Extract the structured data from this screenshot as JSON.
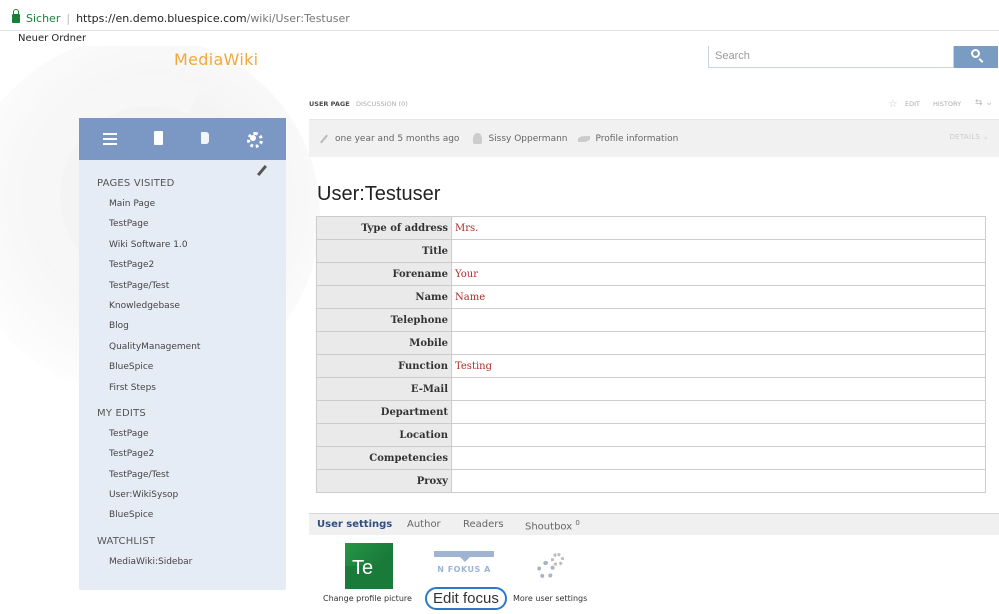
{
  "browser": {
    "secure_label": "Sicher",
    "url_host": "https://en.demo.bluespice.com",
    "url_path": "/wiki/User:Testuser",
    "bookmark": "Neuer Ordner"
  },
  "header": {
    "logo": "MediaWiki",
    "search_placeholder": "Search"
  },
  "topnav": {
    "user_page": "USER PAGE",
    "discussion": "DISCUSSION (0)",
    "edit": "EDIT",
    "history": "HISTORY"
  },
  "infobar": {
    "edited": "one year and 5 months ago",
    "author": "Sissy Oppermann",
    "profile": "Profile information",
    "details": "DETAILS"
  },
  "page_title": "User:Testuser",
  "profile": [
    {
      "label": "Type of address",
      "value": "Mrs."
    },
    {
      "label": "Title",
      "value": ""
    },
    {
      "label": "Forename",
      "value": "Your"
    },
    {
      "label": "Name",
      "value": "Name"
    },
    {
      "label": "Telephone",
      "value": ""
    },
    {
      "label": "Mobile",
      "value": ""
    },
    {
      "label": "Function",
      "value": "Testing"
    },
    {
      "label": "E-Mail",
      "value": ""
    },
    {
      "label": "Department",
      "value": ""
    },
    {
      "label": "Location",
      "value": ""
    },
    {
      "label": "Competencies",
      "value": ""
    },
    {
      "label": "Proxy",
      "value": ""
    }
  ],
  "sidebar": {
    "pages_visited_heading": "PAGES VISITED",
    "pages_visited": [
      "Main Page",
      "TestPage",
      "Wiki Software 1.0",
      "TestPage2",
      "TestPage/Test",
      "Knowledgebase",
      "Blog",
      "QualityManagement",
      "BlueSpice",
      "First Steps"
    ],
    "my_edits_heading": "MY EDITS",
    "my_edits": [
      "TestPage",
      "TestPage2",
      "TestPage/Test",
      "User:WikiSysop",
      "BlueSpice"
    ],
    "watchlist_heading": "WATCHLIST",
    "watchlist": [
      "MediaWiki:Sidebar"
    ]
  },
  "bottom_tabs": {
    "user_settings": "User settings",
    "author": "Author",
    "readers": "Readers",
    "shoutbox": "Shoutbox",
    "shoutbox_count": "0"
  },
  "settings": {
    "te": "Te",
    "focus_text": "N  FOKUS  A",
    "change_picture": "Change profile picture",
    "edit_focus": "Edit focus",
    "more_settings": "More user settings"
  }
}
